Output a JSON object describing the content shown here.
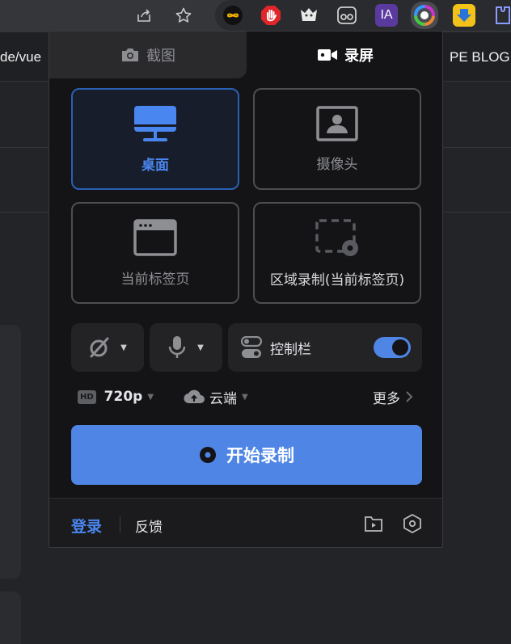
{
  "browser": {
    "bookmarks": [
      "de/vue",
      "PE BLOG"
    ],
    "extension_icons": [
      "infinity-icon",
      "adblock-hand-icon",
      "badger-icon",
      "glasses-icon",
      "ia-icon",
      "color-ring-icon",
      "download-arrow-icon",
      "puzzle-icon"
    ],
    "ia_label": "IA"
  },
  "popup": {
    "tabs": {
      "screenshot": "截图",
      "record": "录屏",
      "active": "record"
    },
    "modes": [
      {
        "id": "desktop",
        "label": "桌面",
        "selected": true
      },
      {
        "id": "camera",
        "label": "摄像头",
        "selected": false
      },
      {
        "id": "current-tab",
        "label": "当前标签页",
        "selected": false
      },
      {
        "id": "region",
        "label": "区域录制(当前标签页)",
        "selected": false
      }
    ],
    "controls": {
      "camera_toggle_icon": "camera-off-icon",
      "mic_icon": "microphone-icon",
      "control_bar_label": "控制栏",
      "control_bar_on": true
    },
    "options": {
      "resolution_badge": "HD",
      "resolution": "720p",
      "storage": "云端",
      "more": "更多"
    },
    "start_button": "开始录制",
    "footer": {
      "login": "登录",
      "feedback": "反馈"
    },
    "colors": {
      "accent": "#4f86e6",
      "selected_text": "#4a86ef",
      "panel_bg": "#141416"
    }
  }
}
